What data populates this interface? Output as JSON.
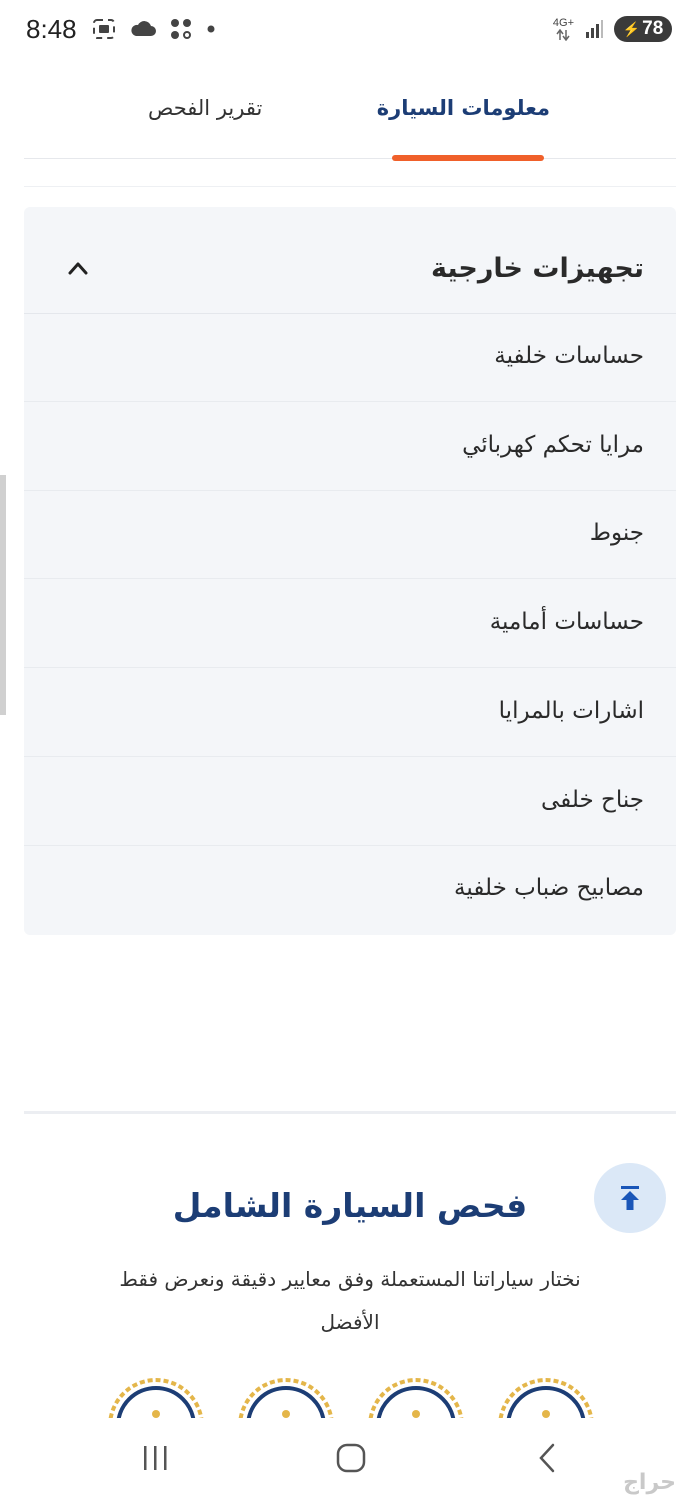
{
  "status_bar": {
    "time": "8:48",
    "network": "4G+",
    "battery": "78",
    "icons_left": [
      "screenshot-icon",
      "cloud-icon",
      "dots-icon",
      "dot-icon"
    ]
  },
  "tabs": [
    {
      "label": "معلومات السيارة",
      "active": true
    },
    {
      "label": "تقرير الفحص",
      "active": false
    }
  ],
  "colors": {
    "accent": "#f0602a",
    "brand": "#1c3d75",
    "panel": "#f4f6f9"
  },
  "accordion": {
    "title": "تجهيزات خارجية",
    "expanded": true,
    "items": [
      {
        "label": "حساسات خلفية"
      },
      {
        "label": "مرايا تحكم كهربائي"
      },
      {
        "label": "جنوط"
      },
      {
        "label": "حساسات أمامية"
      },
      {
        "label": "اشارات بالمرايا"
      },
      {
        "label": "جناح خلفى"
      },
      {
        "label": "مصابيح ضباب خلفية"
      }
    ]
  },
  "footer": {
    "title": "فحص السيارة الشامل",
    "description": "نختار سياراتنا المستعملة وفق معايير دقيقة ونعرض فقط الأفضل"
  },
  "watermark": "حراج"
}
